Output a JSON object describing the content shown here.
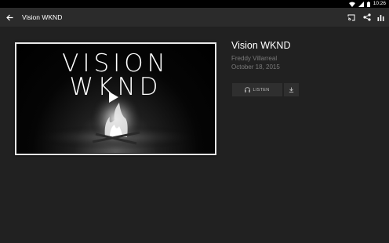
{
  "status_bar": {
    "time": "10:26",
    "icons": [
      "wifi-icon",
      "cellular-signal-icon",
      "battery-icon"
    ]
  },
  "app_bar": {
    "title": "Vision WKND",
    "back_icon": "arrow-back-icon",
    "actions": [
      "cast-icon",
      "share-icon",
      "equalizer-icon"
    ]
  },
  "track": {
    "title": "Vision WKND",
    "artist": "Freddy Villarreal",
    "date": "October 18, 2015",
    "artwork_text": [
      "VISION",
      "WKND"
    ]
  },
  "actions": {
    "listen_label": "LISTEN",
    "listen_icon": "headphones-icon",
    "download_icon": "download-icon",
    "play_icon": "play-icon"
  },
  "colors": {
    "background": "#212121",
    "app_bar": "#2b2b2b",
    "button_bg": "#2f2f2f",
    "secondary_text": "#7a7a7a"
  }
}
